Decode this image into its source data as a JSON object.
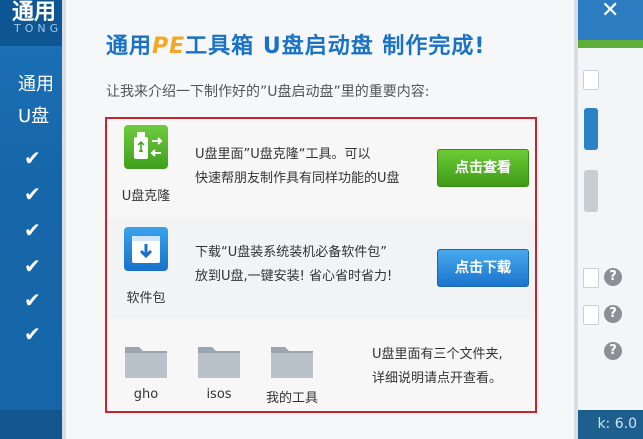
{
  "background": {
    "title": "通用",
    "subtitle": "TONG",
    "line1": "通用",
    "line2": "U盘",
    "version": "k: 6.0",
    "close": "✕",
    "help": "?"
  },
  "dialog": {
    "title_prefix": "通用",
    "title_pe": "PE",
    "title_suffix": "工具箱  U盘启动盘  制作完成!",
    "intro": "让我来介绍一下制作好的”U盘启动盘”里的重要内容:",
    "sections": {
      "clone": {
        "icon_label": "U盘克隆",
        "line1": "U盘里面”U盘克隆“工具。可以",
        "line2": "快速帮朋友制作具有同样功能的U盘",
        "button": "点击查看"
      },
      "software": {
        "icon_label": "软件包",
        "line1": "下载“U盘装系统装机必备软件包”",
        "line2": "放到U盘,一键安装! 省心省时省力!",
        "button": "点击下载"
      },
      "folders": {
        "items": [
          "gho",
          "isos",
          "我的工具"
        ],
        "note_line1": "U盘里面有三个文件夹,",
        "note_line2": "详细说明请点开查看。"
      }
    }
  },
  "colors": {
    "title_blue": "#1a72c6",
    "pe_orange": "#f3a824",
    "panel_border": "#c9242e",
    "green_button": "#4fae23",
    "blue_button": "#2b86d9"
  },
  "icons": {
    "clone": "usb-clone-icon",
    "software": "download-box-icon",
    "folder": "folder-icon"
  }
}
